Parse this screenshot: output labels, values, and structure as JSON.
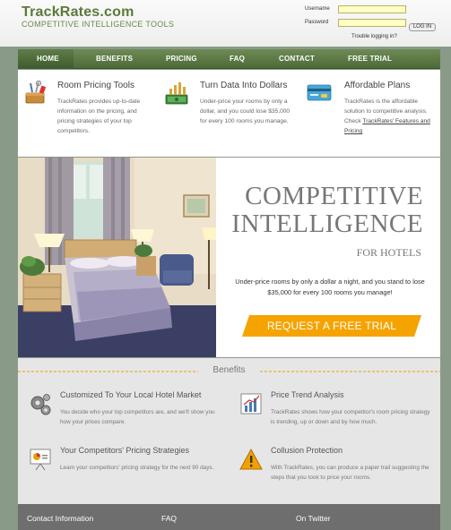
{
  "header": {
    "logo": "TrackRates.com",
    "tagline": "COMPETITIVE INTELLIGENCE TOOLS",
    "login": {
      "username_label": "Username",
      "password_label": "Password",
      "login_button": "LOG IN",
      "trouble_link": "Trouble logging in?"
    }
  },
  "nav": {
    "items": [
      "HOME",
      "BENEFITS",
      "PRICING",
      "FAQ",
      "CONTACT",
      "FREE TRIAL"
    ]
  },
  "features": [
    {
      "title": "Room Pricing Tools",
      "text": "TrackRates provides up-to-date information on the pricing, and pricing strategies of your top competitors.",
      "icon": "tools-icon"
    },
    {
      "title": "Turn Data Into Dollars",
      "text": "Under-price your rooms by only a dollar, and you could lose $35,000 for every 100 rooms you manage.",
      "icon": "money-chart-icon"
    },
    {
      "title": "Affordable Plans",
      "text_before_link": "TrackRates is the affordable solution to competitive analysis. Check ",
      "link": "TrackRates' Features and Pricing",
      "icon": "credit-card-icon"
    }
  ],
  "hero": {
    "headline_line1": "COMPETITIVE",
    "headline_line2": "INTELLIGENCE",
    "subheadline": "FOR HOTELS",
    "pitch": "Under-price rooms by only a dollar a night, and you stand to lose $35,000 for every 100 rooms you manage!",
    "cta": "REQUEST A FREE TRIAL",
    "cta_color": "#f5a300"
  },
  "benefits": {
    "title": "Benefits",
    "items": [
      {
        "title": "Customized To Your Local Hotel Market",
        "text": "You decide who your top competitors are, and we'll show you how your prices compare.",
        "icon": "gears-icon"
      },
      {
        "title": "Price Trend Analysis",
        "text": "TrackRates shows how your competitor's room pricing strategy is trending, up or down and by how much.",
        "icon": "trend-chart-icon"
      },
      {
        "title": "Your Competitors' Pricing Strategies",
        "text": "Learn your competitors' pricing strategy for the next 90 days.",
        "icon": "presentation-icon"
      },
      {
        "title": "Collusion Protection",
        "text": "With TrackRates, you can produce a paper trail suggesting the steps that you took to price your rooms.",
        "icon": "warning-icon"
      }
    ]
  },
  "footer": {
    "contact": "Contact Information",
    "faq": "FAQ",
    "twitter": "On Twitter"
  },
  "colors": {
    "brand_green": "#5b7a3a",
    "nav_green": "#4d6a39",
    "page_bg": "#8a9a88",
    "cta_orange": "#f5a300",
    "footer_gray": "#6e6e6e"
  }
}
